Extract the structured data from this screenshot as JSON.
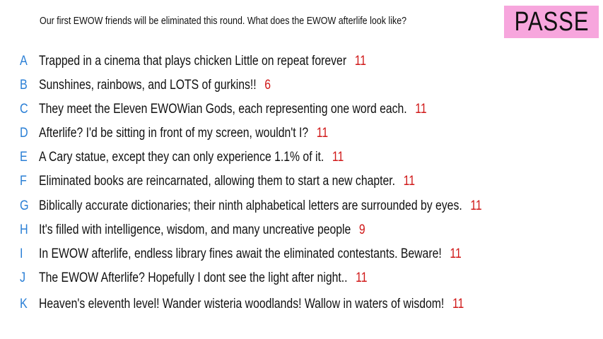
{
  "prompt": "Our first EWOW friends will be eliminated this round. What does the EWOW afterlife look like?",
  "badge": {
    "label": "PASSE",
    "color": "#f7a6dd"
  },
  "colors": {
    "letter": "#2a7fd6",
    "score": "#d01818",
    "text": "#111111"
  },
  "entries": [
    {
      "letter": "A",
      "text": "Trapped in a cinema that plays chicken Little on repeat forever",
      "score": "11"
    },
    {
      "letter": "B",
      "text": "Sunshines, rainbows, and LOTS of gurkins!!",
      "score": "6"
    },
    {
      "letter": "C",
      "text": "They meet the Eleven EWOWian Gods, each representing one word each.",
      "score": "11"
    },
    {
      "letter": "D",
      "text": "Afterlife? I'd be sitting in front of my screen, wouldn't I?",
      "score": "11"
    },
    {
      "letter": "E",
      "text": "A Cary statue, except they can only experience 1.1% of it.",
      "score": "11"
    },
    {
      "letter": "F",
      "text": "Eliminated books are reincarnated, allowing them to start a new chapter.",
      "score": "11"
    },
    {
      "letter": "G",
      "text": "Biblically accurate dictionaries; their ninth alphabetical letters are surrounded by eyes.",
      "score": "11"
    },
    {
      "letter": "H",
      "text": "It's filled with intelligence, wisdom, and many uncreative people",
      "score": "9"
    },
    {
      "letter": "I",
      "text": "In EWOW afterlife, endless library fines await the eliminated contestants. Beware!",
      "score": "11"
    },
    {
      "letter": "J",
      "text": "The EWOW Afterlife? Hopefully I dont see the light after night..",
      "score": "11"
    },
    {
      "letter": "K",
      "text": "Heaven's eleventh level! Wander wisteria woodlands! Wallow in waters of wisdom!",
      "score": "11"
    }
  ]
}
